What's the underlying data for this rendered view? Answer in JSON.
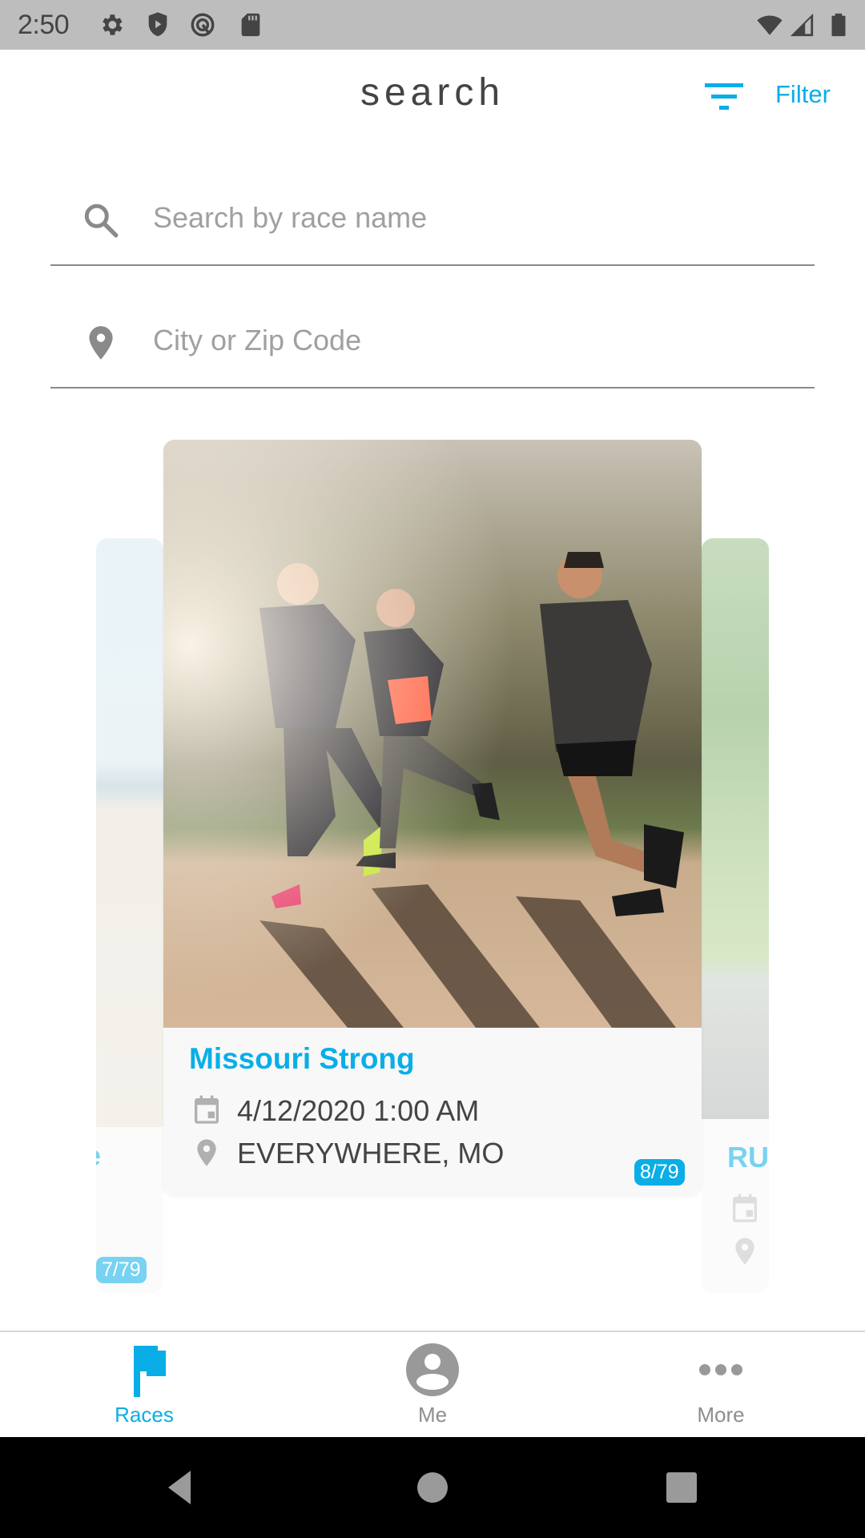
{
  "status_bar": {
    "time": "2:50",
    "left_icons": [
      "settings-icon",
      "play-protect-icon",
      "q-logo-icon",
      "sd-card-icon"
    ],
    "right_icons": [
      "wifi-icon",
      "cell-signal-icon",
      "battery-icon"
    ]
  },
  "header": {
    "title": "search",
    "filter_label": "Filter",
    "accent_color": "#0aaee6"
  },
  "search": {
    "race_name_placeholder": "Search by race name",
    "race_name_value": "",
    "location_placeholder": "City or Zip Code",
    "location_value": ""
  },
  "carousel": {
    "previous_card": {
      "title_fragment": "e",
      "counter": "7/79"
    },
    "current_card": {
      "title": "Missouri Strong",
      "date": "4/12/2020 1:00 AM",
      "location": "EVERYWHERE, MO",
      "counter": "8/79"
    },
    "next_card": {
      "title_fragment": "RU"
    }
  },
  "bottom_nav": {
    "items": [
      {
        "label": "Races",
        "icon": "flag-icon",
        "active": true
      },
      {
        "label": "Me",
        "icon": "account-circle-icon",
        "active": false
      },
      {
        "label": "More",
        "icon": "more-horizontal-icon",
        "active": false
      }
    ]
  },
  "system_nav": {
    "buttons": [
      "back",
      "home",
      "recents"
    ]
  }
}
